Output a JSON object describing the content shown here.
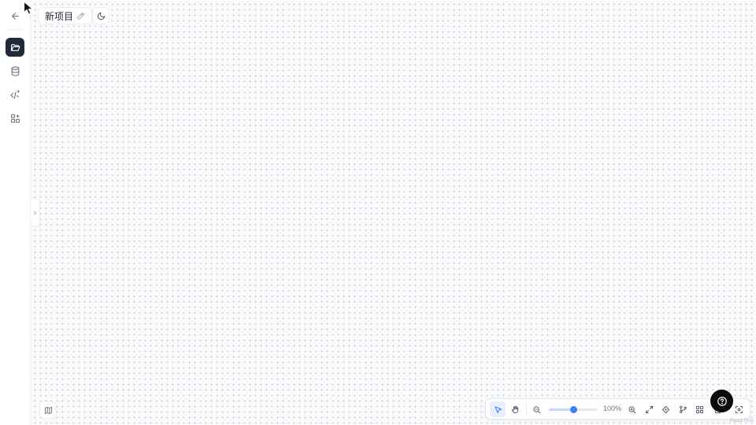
{
  "project": {
    "title": "新项目"
  },
  "sidebar": {
    "items": [
      {
        "name": "back",
        "icon": "arrow-left-icon"
      },
      {
        "name": "project-files",
        "icon": "folder-open-icon",
        "active": true
      },
      {
        "name": "database",
        "icon": "database-icon"
      },
      {
        "name": "code-ai",
        "icon": "code-sparkle-icon"
      },
      {
        "name": "components",
        "icon": "shapes-plus-icon"
      }
    ]
  },
  "toolbar": {
    "zoom_label": "100%",
    "zoom_fraction": 0.5,
    "tools": [
      "select-pointer-icon",
      "hand-pan-icon",
      "zoom-out-icon",
      "zoom-in-icon",
      "fit-expand-icon",
      "diamond-node-icon",
      "git-branch-icon",
      "grid-icon",
      "lock-icon",
      "focus-scan-icon"
    ]
  },
  "attribution": "React Flow",
  "colors": {
    "accent": "#3b82f6",
    "active_sidebar": "#1f2937",
    "help_button": "#0b0b0c",
    "canvas_bg": "#f9fafb"
  }
}
